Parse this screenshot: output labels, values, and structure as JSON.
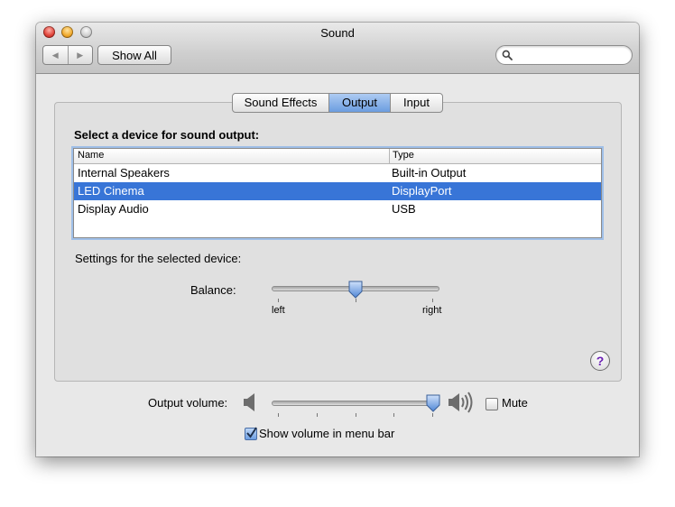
{
  "window": {
    "title": "Sound"
  },
  "toolbar": {
    "back_glyph": "◀",
    "forward_glyph": "▶",
    "show_all_label": "Show All",
    "search_placeholder": "",
    "search_value": ""
  },
  "tabs": [
    {
      "label": "Sound Effects",
      "selected": false
    },
    {
      "label": "Output",
      "selected": true
    },
    {
      "label": "Input",
      "selected": false
    }
  ],
  "output": {
    "heading": "Select a device for sound output:",
    "columns": {
      "name": "Name",
      "type": "Type"
    },
    "devices": [
      {
        "name": "Internal Speakers",
        "type": "Built-in Output",
        "selected": false
      },
      {
        "name": "LED Cinema",
        "type": "DisplayPort",
        "selected": true
      },
      {
        "name": "Display Audio",
        "type": "USB",
        "selected": false
      }
    ],
    "settings_label": "Settings for the selected device:",
    "balance": {
      "label": "Balance:",
      "left_label": "left",
      "right_label": "right",
      "value": 0.5
    }
  },
  "help": {
    "glyph": "?"
  },
  "volume": {
    "label": "Output volume:",
    "value": 1.0,
    "mute_label": "Mute",
    "mute_checked": false,
    "menubar_label": "Show volume in menu bar",
    "menubar_checked": true
  },
  "icons": {
    "search": "magnifier-icon",
    "volume_low": "speaker-low-icon",
    "volume_high": "speaker-high-icon",
    "help": "help-icon"
  },
  "colors": {
    "selection": "#3875d7",
    "tab_selected": "#6b9de0",
    "help_mark": "#6a1fb3"
  }
}
